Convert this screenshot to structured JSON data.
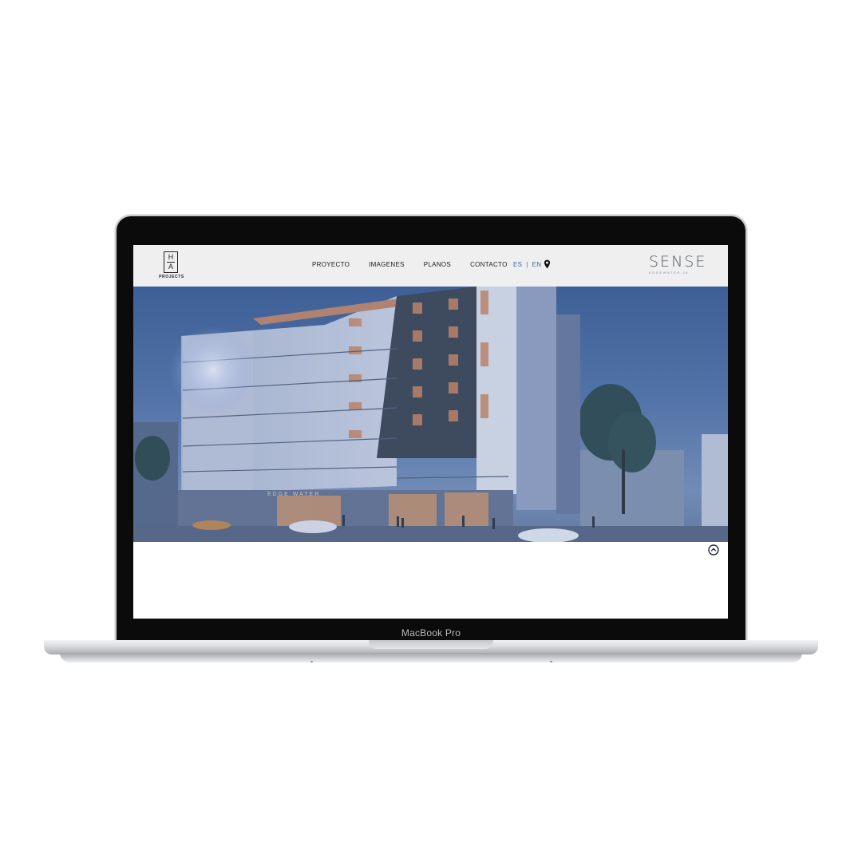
{
  "device": {
    "label": "MacBook Pro"
  },
  "site": {
    "logo_top": "H",
    "logo_bottom": "A",
    "logo_word": "PROJECTS",
    "nav": [
      {
        "label": "PROYECTO"
      },
      {
        "label": "IMAGENES"
      },
      {
        "label": "PLANOS"
      },
      {
        "label": "CONTACTO"
      }
    ],
    "lang": {
      "es": "ES",
      "sep": "|",
      "en": "EN"
    },
    "location_icon": "map-pin-icon",
    "brand": {
      "name": "SENSE",
      "tagline": "EDGEWATER 28"
    },
    "hero": {
      "signage": "EDGE WATER"
    },
    "scroll_icon": "chevron-up-circle-icon"
  },
  "colors": {
    "header_bg": "#efefef",
    "lang_accent": "#3d6fa8",
    "brand_text": "#545a61"
  }
}
